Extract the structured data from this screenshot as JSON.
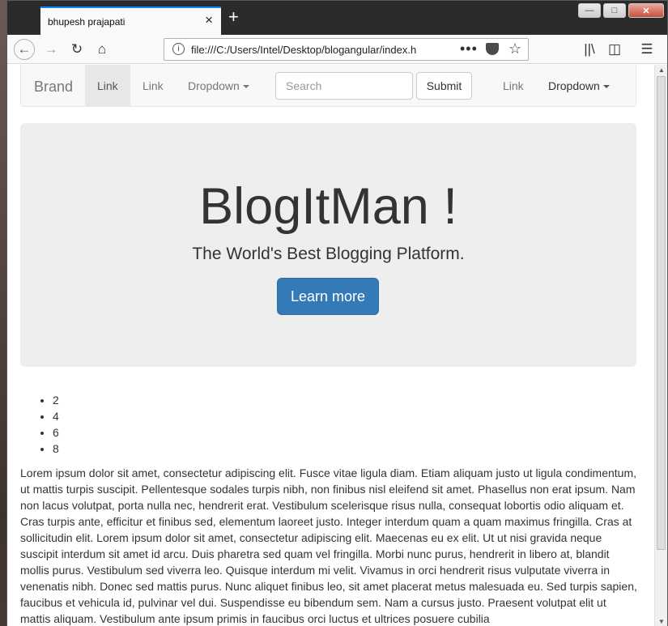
{
  "browser": {
    "tab_title": "bhupesh prajapati",
    "tab_close": "×",
    "new_tab": "+",
    "url": "file:///C:/Users/Intel/Desktop/blogangular/index.h",
    "url_more": "•••",
    "icons": [
      "back-icon",
      "forward-icon",
      "reload-icon",
      "home-icon",
      "info-icon",
      "more-icon",
      "pocket-icon",
      "star-icon",
      "library-icon",
      "sidebar-icon",
      "menu-icon"
    ]
  },
  "navbar": {
    "brand": "Brand",
    "link_active": "Link",
    "link2": "Link",
    "dropdown": "Dropdown",
    "search_placeholder": "Search",
    "submit": "Submit",
    "right_link": "Link",
    "right_dropdown": "Dropdown"
  },
  "jumbotron": {
    "title": "BlogItMan !",
    "subtitle": "The World's Best Blogging Platform.",
    "button": "Learn more"
  },
  "list": [
    "2",
    "4",
    "6",
    "8"
  ],
  "body_text": "Lorem ipsum dolor sit amet, consectetur adipiscing elit. Fusce vitae ligula diam. Etiam aliquam justo ut ligula condimentum, ut mattis turpis suscipit. Pellentesque sodales turpis nibh, non finibus nisl eleifend sit amet. Phasellus non erat ipsum. Nam non lacus volutpat, porta nulla nec, hendrerit erat. Vestibulum scelerisque risus nulla, consequat lobortis odio aliquam et. Cras turpis ante, efficitur et finibus sed, elementum laoreet justo. Integer interdum quam a quam maximus fringilla. Cras at sollicitudin elit. Lorem ipsum dolor sit amet, consectetur adipiscing elit. Maecenas eu ex elit. Ut ut nisi gravida neque suscipit interdum sit amet id arcu. Duis pharetra sed quam vel fringilla. Morbi nunc purus, hendrerit in libero at, blandit mollis purus. Vestibulum sed viverra leo. Quisque interdum mi velit. Vivamus in orci hendrerit risus vulputate viverra in venenatis nibh. Donec sed mattis purus. Nunc aliquet finibus leo, sit amet placerat metus malesuada eu. Sed turpis sapien, faucibus et vehicula id, pulvinar vel dui. Suspendisse eu bibendum sem. Nam a cursus justo. Praesent volutpat elit ut mattis aliquam. Vestibulum ante ipsum primis in faucibus orci luctus et ultrices posuere cubilia",
  "colors": {
    "primary": "#337ab7",
    "jumbotron_bg": "#eeeeee",
    "navbar_bg": "#f8f8f8",
    "tab_accent": "#0a84ff"
  }
}
